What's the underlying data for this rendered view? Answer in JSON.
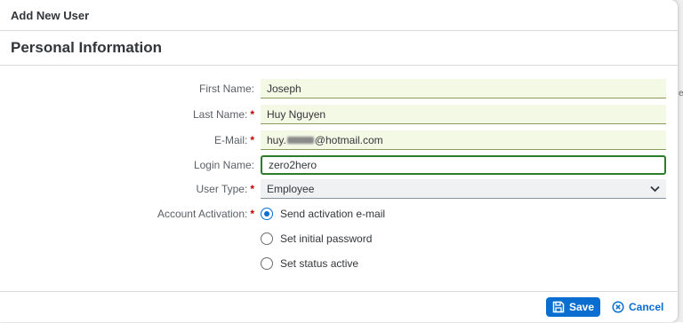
{
  "dialog": {
    "title": "Add New User",
    "section_title": "Personal Information"
  },
  "form": {
    "first_name": {
      "label": "First Name:",
      "value": "Joseph",
      "required": false
    },
    "last_name": {
      "label": "Last Name:",
      "value": "Huy Nguyen",
      "required": true
    },
    "email": {
      "label": "E-Mail:",
      "value_prefix": "huy.",
      "value_suffix": "@hotmail.com",
      "required": true
    },
    "login_name": {
      "label": "Login Name:",
      "value": "zero2hero",
      "required": false
    },
    "user_type": {
      "label": "User Type:",
      "value": "Employee",
      "required": true
    },
    "account_activation": {
      "label": "Account Activation:",
      "required": true,
      "options": [
        {
          "label": "Send activation e-mail",
          "selected": true
        },
        {
          "label": "Set initial password",
          "selected": false
        },
        {
          "label": "Set status active",
          "selected": false
        }
      ]
    },
    "required_marker": "*"
  },
  "footer": {
    "save_label": "Save",
    "cancel_label": "Cancel"
  },
  "colors": {
    "accent": "#0a6ed1",
    "required": "#bb0000",
    "focus": "#2b7d2b"
  }
}
